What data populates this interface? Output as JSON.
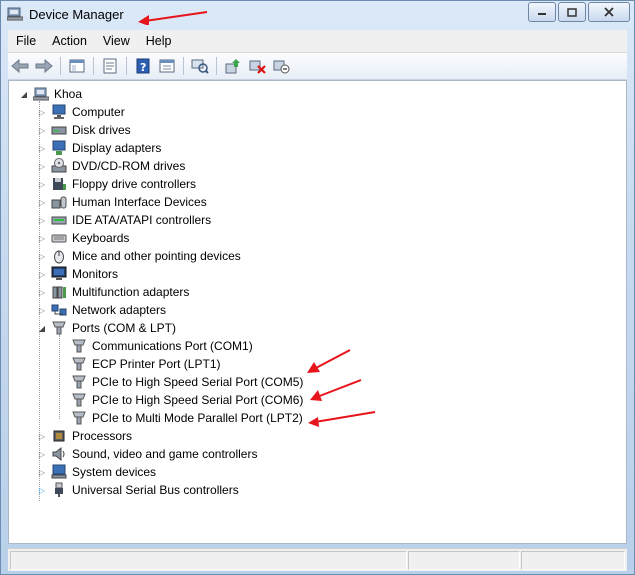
{
  "window": {
    "title": "Device Manager"
  },
  "menu": [
    "File",
    "Action",
    "View",
    "Help"
  ],
  "tree": {
    "root": "Khoa",
    "categories": [
      {
        "label": "Computer",
        "icon": "computer-icon"
      },
      {
        "label": "Disk drives",
        "icon": "disk-drive-icon"
      },
      {
        "label": "Display adapters",
        "icon": "display-adapter-icon"
      },
      {
        "label": "DVD/CD-ROM drives",
        "icon": "dvd-drive-icon"
      },
      {
        "label": "Floppy drive controllers",
        "icon": "floppy-controller-icon"
      },
      {
        "label": "Human Interface Devices",
        "icon": "hid-icon"
      },
      {
        "label": "IDE ATA/ATAPI controllers",
        "icon": "ide-controller-icon"
      },
      {
        "label": "Keyboards",
        "icon": "keyboard-icon"
      },
      {
        "label": "Mice and other pointing devices",
        "icon": "mouse-icon"
      },
      {
        "label": "Monitors",
        "icon": "monitor-icon"
      },
      {
        "label": "Multifunction adapters",
        "icon": "multifunction-icon"
      },
      {
        "label": "Network adapters",
        "icon": "network-adapter-icon"
      },
      {
        "label": "Ports (COM & LPT)",
        "icon": "port-icon",
        "expanded": true,
        "children": [
          "Communications Port (COM1)",
          "ECP Printer Port (LPT1)",
          "PCIe to High Speed Serial Port (COM5)",
          "PCIe to High Speed Serial Port (COM6)",
          "PCIe to Multi Mode Parallel Port (LPT2)"
        ]
      },
      {
        "label": "Processors",
        "icon": "processor-icon"
      },
      {
        "label": "Sound, video and game controllers",
        "icon": "sound-icon"
      },
      {
        "label": "System devices",
        "icon": "system-device-icon"
      },
      {
        "label": "Universal Serial Bus controllers",
        "icon": "usb-icon"
      }
    ]
  },
  "colors": {
    "annotation_arrow": "#e8141b",
    "titlebar": "#c7daf0"
  }
}
